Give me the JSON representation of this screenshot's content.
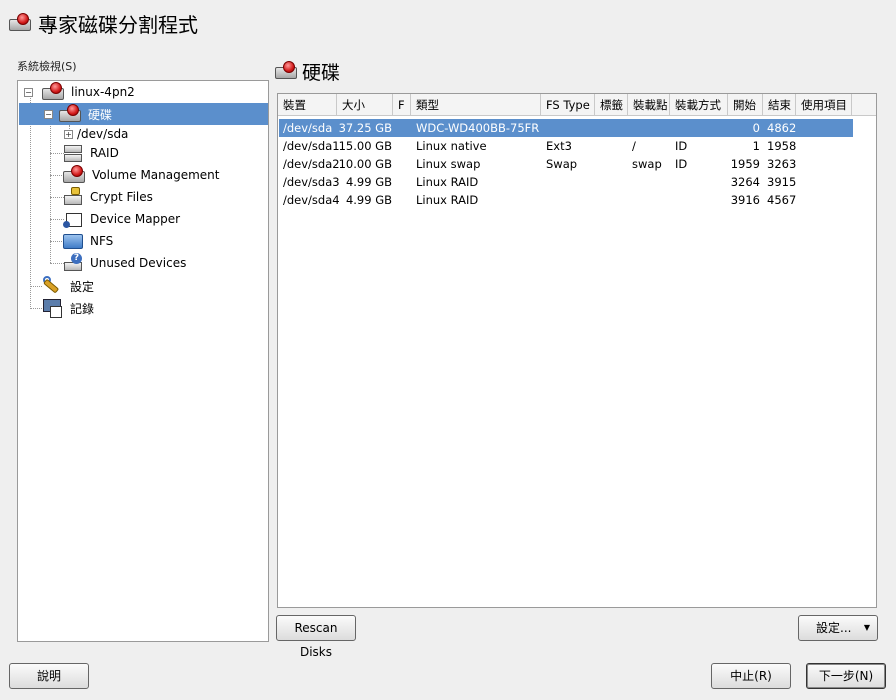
{
  "window": {
    "title": "專家磁碟分割程式",
    "icon": "hard-disk-icon"
  },
  "sidebar": {
    "label": "系統檢視(S)",
    "tree": [
      {
        "label": "linux-4pn2",
        "icon": "computer-disk-icon"
      },
      {
        "label": "硬碟",
        "icon": "hard-disk-icon",
        "selected": true
      },
      {
        "label": "/dev/sda"
      },
      {
        "label": "RAID",
        "icon": "raid-icon"
      },
      {
        "label": "Volume Management",
        "icon": "volume-management-icon"
      },
      {
        "label": "Crypt Files",
        "icon": "crypt-files-icon"
      },
      {
        "label": "Device Mapper",
        "icon": "device-mapper-icon"
      },
      {
        "label": "NFS",
        "icon": "nfs-icon"
      },
      {
        "label": "Unused Devices",
        "icon": "unused-devices-icon"
      },
      {
        "label": "設定",
        "icon": "settings-wrench-icon"
      },
      {
        "label": "記錄",
        "icon": "log-icon"
      }
    ]
  },
  "main": {
    "title": "硬碟",
    "columns": [
      "裝置",
      "大小",
      "F",
      "類型",
      "FS Type",
      "標籤",
      "裝載點",
      "裝載方式",
      "開始",
      "結束",
      "使用項目"
    ],
    "rows": [
      {
        "device": "/dev/sda",
        "size": "37.25 GB",
        "f": "",
        "type": "WDC-WD400BB-75FR",
        "fs_type": "",
        "label": "",
        "mount": "",
        "mount_by": "",
        "start": "0",
        "end": "4862",
        "used_by": "",
        "selected": true
      },
      {
        "device": "/dev/sda1",
        "size": "15.00 GB",
        "f": "",
        "type": "Linux native",
        "fs_type": "Ext3",
        "label": "",
        "mount": "/",
        "mount_by": "ID",
        "start": "1",
        "end": "1958",
        "used_by": ""
      },
      {
        "device": "/dev/sda2",
        "size": "10.00 GB",
        "f": "",
        "type": "Linux swap",
        "fs_type": "Swap",
        "label": "",
        "mount": "swap",
        "mount_by": "ID",
        "start": "1959",
        "end": "3263",
        "used_by": ""
      },
      {
        "device": "/dev/sda3",
        "size": "4.99 GB",
        "f": "",
        "type": "Linux RAID",
        "fs_type": "",
        "label": "",
        "mount": "",
        "mount_by": "",
        "start": "3264",
        "end": "3915",
        "used_by": ""
      },
      {
        "device": "/dev/sda4",
        "size": "4.99 GB",
        "f": "",
        "type": "Linux RAID",
        "fs_type": "",
        "label": "",
        "mount": "",
        "mount_by": "",
        "start": "3916",
        "end": "4567",
        "used_by": ""
      }
    ]
  },
  "buttons": {
    "rescan": "Rescan Disks",
    "settings": "設定...",
    "help": "說明",
    "abort": "中止(R)",
    "next": "下一步(N)"
  },
  "colors": {
    "selection": "#5b8fcc"
  }
}
